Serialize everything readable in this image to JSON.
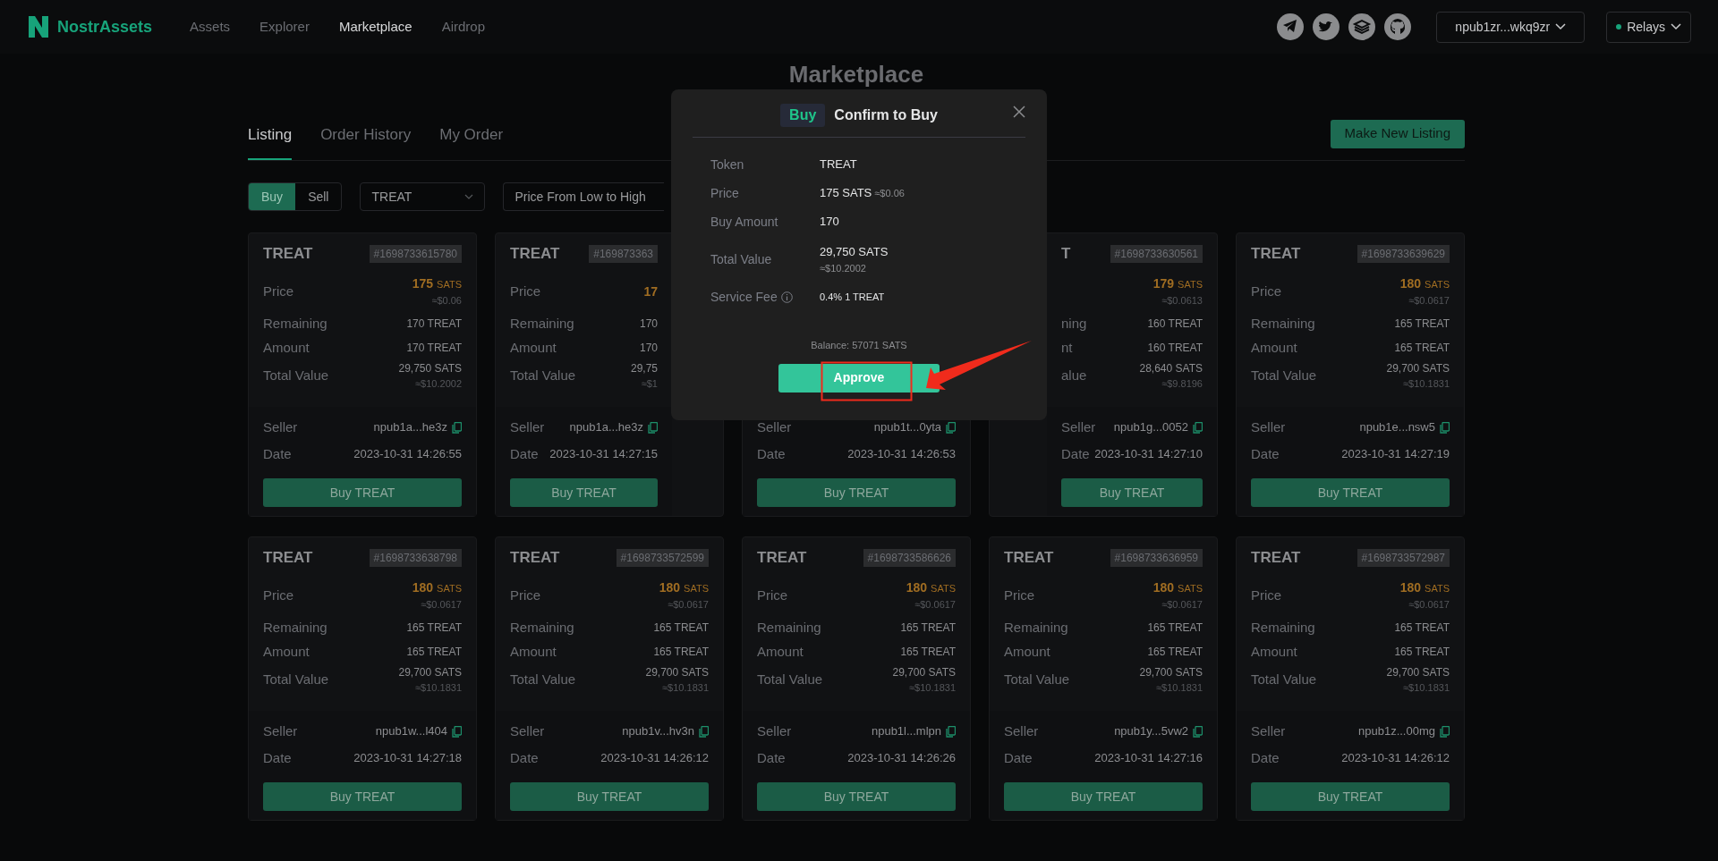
{
  "header": {
    "brand": "NostrAssets",
    "nav": [
      {
        "label": "Assets",
        "selected": false
      },
      {
        "label": "Explorer",
        "selected": false
      },
      {
        "label": "Marketplace",
        "selected": true
      },
      {
        "label": "Airdrop",
        "selected": false
      }
    ],
    "social": [
      {
        "kind": "telegram"
      },
      {
        "kind": "twitter"
      },
      {
        "kind": "stack"
      },
      {
        "kind": "github"
      }
    ],
    "account": "npub1zr...wkq9zr",
    "relays": "Relays"
  },
  "page_title": "Marketplace",
  "tabs": [
    {
      "label": "Listing",
      "selected": true
    },
    {
      "label": "Order History",
      "selected": false
    },
    {
      "label": "My Order",
      "selected": false
    }
  ],
  "new_listing_button": "Make New Listing",
  "filters": {
    "side": [
      {
        "label": "Buy",
        "selected": true
      },
      {
        "label": "Sell",
        "selected": false
      }
    ],
    "token": "TREAT",
    "sort": "Price From Low to High"
  },
  "cards": [
    {
      "kind": "full",
      "title": "TREAT",
      "tag": "#1698733615780",
      "price_label": "Price",
      "price": "175",
      "price_unit": "SATS",
      "price_usd": "≈$0.06",
      "remaining_label": "Remaining",
      "remaining": "170 TREAT",
      "amount_label": "Amount",
      "amount": "170 TREAT",
      "total_label": "Total Value",
      "total": "29,750 SATS",
      "total_usd": "≈$10.2002",
      "seller_label": "Seller",
      "seller": "npub1a...he3z",
      "date_label": "Date",
      "date": "2023-10-31 14:26:55",
      "button": "Buy TREAT"
    },
    {
      "kind": "clipped_right",
      "title": "TREAT",
      "tag": "#169873363",
      "price_label": "Price",
      "price": "17",
      "remaining_label": "Remaining",
      "remaining": "170",
      "amount_label": "Amount",
      "amount": "170",
      "total_label": "Total Value",
      "total": "29,75",
      "total_usd": "≈$1",
      "seller_label": "Seller",
      "seller": "npub1a...he3z",
      "date_label": "Date",
      "date": "2023-10-31 14:27:15",
      "button": "Buy TREAT"
    },
    {
      "kind": "clipped_top",
      "seller_label": "Seller",
      "seller": "npub1t...0yta",
      "date_label": "Date",
      "date": "2023-10-31 14:26:53",
      "button": "Buy TREAT"
    },
    {
      "kind": "clipped_left",
      "title": "T",
      "tag": "#1698733630561",
      "price": "179",
      "price_unit": "SATS",
      "price_usd": "≈$0.0613",
      "remaining_label": "ning",
      "remaining": "160 TREAT",
      "amount_label": "nt",
      "amount": "160 TREAT",
      "total_label": "alue",
      "total": "28,640 SATS",
      "total_usd": "≈$9.8196",
      "seller_label": "Seller",
      "seller": "npub1g...0052",
      "date_label": "Date",
      "date": "2023-10-31 14:27:10",
      "button": "Buy TREAT"
    },
    {
      "kind": "full",
      "title": "TREAT",
      "tag": "#1698733639629",
      "price_label": "Price",
      "price": "180",
      "price_unit": "SATS",
      "price_usd": "≈$0.0617",
      "remaining_label": "Remaining",
      "remaining": "165 TREAT",
      "amount_label": "Amount",
      "amount": "165 TREAT",
      "total_label": "Total Value",
      "total": "29,700 SATS",
      "total_usd": "≈$10.1831",
      "seller_label": "Seller",
      "seller": "npub1e...nsw5",
      "date_label": "Date",
      "date": "2023-10-31 14:27:19",
      "button": "Buy TREAT"
    },
    {
      "kind": "full",
      "title": "TREAT",
      "tag": "#1698733638798",
      "price_label": "Price",
      "price": "180",
      "price_unit": "SATS",
      "price_usd": "≈$0.0617",
      "remaining_label": "Remaining",
      "remaining": "165 TREAT",
      "amount_label": "Amount",
      "amount": "165 TREAT",
      "total_label": "Total Value",
      "total": "29,700 SATS",
      "total_usd": "≈$10.1831",
      "seller_label": "Seller",
      "seller": "npub1w...l404",
      "date_label": "Date",
      "date": "2023-10-31 14:27:18",
      "button": "Buy TREAT"
    },
    {
      "kind": "full",
      "title": "TREAT",
      "tag": "#1698733572599",
      "price_label": "Price",
      "price": "180",
      "price_unit": "SATS",
      "price_usd": "≈$0.0617",
      "remaining_label": "Remaining",
      "remaining": "165 TREAT",
      "amount_label": "Amount",
      "amount": "165 TREAT",
      "total_label": "Total Value",
      "total": "29,700 SATS",
      "total_usd": "≈$10.1831",
      "seller_label": "Seller",
      "seller": "npub1v...hv3n",
      "date_label": "Date",
      "date": "2023-10-31 14:26:12",
      "button": "Buy TREAT"
    },
    {
      "kind": "full",
      "title": "TREAT",
      "tag": "#1698733586626",
      "price_label": "Price",
      "price": "180",
      "price_unit": "SATS",
      "price_usd": "≈$0.0617",
      "remaining_label": "Remaining",
      "remaining": "165 TREAT",
      "amount_label": "Amount",
      "amount": "165 TREAT",
      "total_label": "Total Value",
      "total": "29,700 SATS",
      "total_usd": "≈$10.1831",
      "seller_label": "Seller",
      "seller": "npub1l...mlpn",
      "date_label": "Date",
      "date": "2023-10-31 14:26:26",
      "button": "Buy TREAT"
    },
    {
      "kind": "full",
      "title": "TREAT",
      "tag": "#1698733636959",
      "price_label": "Price",
      "price": "180",
      "price_unit": "SATS",
      "price_usd": "≈$0.0617",
      "remaining_label": "Remaining",
      "remaining": "165 TREAT",
      "amount_label": "Amount",
      "amount": "165 TREAT",
      "total_label": "Total Value",
      "total": "29,700 SATS",
      "total_usd": "≈$10.1831",
      "seller_label": "Seller",
      "seller": "npub1y...5vw2",
      "date_label": "Date",
      "date": "2023-10-31 14:27:16",
      "button": "Buy TREAT"
    },
    {
      "kind": "full",
      "title": "TREAT",
      "tag": "#1698733572987",
      "price_label": "Price",
      "price": "180",
      "price_unit": "SATS",
      "price_usd": "≈$0.0617",
      "remaining_label": "Remaining",
      "remaining": "165 TREAT",
      "amount_label": "Amount",
      "amount": "165 TREAT",
      "total_label": "Total Value",
      "total": "29,700 SATS",
      "total_usd": "≈$10.1831",
      "seller_label": "Seller",
      "seller": "npub1z...00mg",
      "date_label": "Date",
      "date": "2023-10-31 14:26:12",
      "button": "Buy TREAT"
    }
  ],
  "modal": {
    "badge": "Buy",
    "title": "Confirm to Buy",
    "rows": [
      {
        "kind": "plain",
        "label": "Token",
        "value": "TREAT"
      },
      {
        "kind": "inline",
        "label": "Price",
        "value": "175 SATS",
        "sub": "≈$0.06"
      },
      {
        "kind": "plain",
        "label": "Buy Amount",
        "value": "170"
      },
      {
        "kind": "stacked",
        "label": "Total Value",
        "value": "29,750 SATS",
        "sub": "≈$10.2002"
      },
      {
        "kind": "info",
        "label": "Service Fee",
        "value": "0.4% 1 TREAT"
      }
    ],
    "balance": "Balance: 57071 SATS",
    "approve": "Approve"
  }
}
